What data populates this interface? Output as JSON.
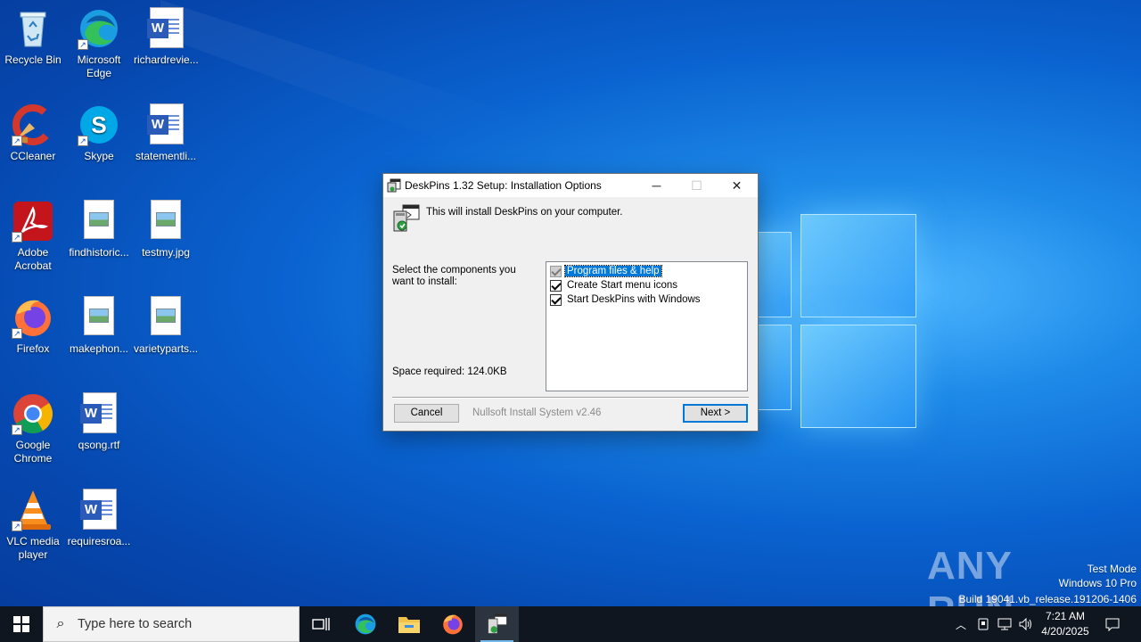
{
  "desktop": {
    "icons": [
      {
        "label": "Recycle Bin",
        "icon": "recycle-bin-icon"
      },
      {
        "label": "Microsoft Edge",
        "icon": "edge-icon"
      },
      {
        "label": "richardrevie...",
        "icon": "word-document-icon"
      },
      {
        "label": "CCleaner",
        "icon": "ccleaner-icon"
      },
      {
        "label": "Skype",
        "icon": "skype-icon"
      },
      {
        "label": "statementli...",
        "icon": "word-document-icon"
      },
      {
        "label": "Adobe Acrobat",
        "icon": "acrobat-icon"
      },
      {
        "label": "findhistoric...",
        "icon": "image-file-icon"
      },
      {
        "label": "testmy.jpg",
        "icon": "image-file-icon"
      },
      {
        "label": "Firefox",
        "icon": "firefox-icon"
      },
      {
        "label": "makephon...",
        "icon": "image-file-icon"
      },
      {
        "label": "varietyparts...",
        "icon": "image-file-icon"
      },
      {
        "label": "Google Chrome",
        "icon": "chrome-icon"
      },
      {
        "label": "qsong.rtf",
        "icon": "word-document-icon"
      },
      {
        "label": "VLC media player",
        "icon": "vlc-icon"
      },
      {
        "label": "requiresroa...",
        "icon": "word-document-icon"
      }
    ]
  },
  "dialog": {
    "title": "DeskPins 1.32 Setup: Installation Options",
    "header_text": "This will install DeskPins on your computer.",
    "components_label": "Select the components you want to install:",
    "space_required": "Space required: 124.0KB",
    "components": [
      {
        "label": "Program files & help",
        "checked": true,
        "disabled": true,
        "selected": true
      },
      {
        "label": "Create Start menu icons",
        "checked": true,
        "disabled": false,
        "selected": false
      },
      {
        "label": "Start DeskPins with Windows",
        "checked": true,
        "disabled": false,
        "selected": false
      }
    ],
    "branding": "Nullsoft Install System v2.46",
    "cancel_label": "Cancel",
    "next_label": "Next >",
    "minimize_glyph": "─",
    "maximize_glyph": "☐",
    "close_glyph": "✕"
  },
  "watermark": {
    "text": "ANY RUN",
    "mode": "Test Mode",
    "edition": "Windows 10 Pro",
    "build": "Build 19041.vb_release.191206-1406"
  },
  "taskbar": {
    "search_placeholder": "Type here to search",
    "time": "7:21 AM",
    "date": "4/20/2025",
    "pinned": [
      "task-view-icon",
      "edge-icon",
      "file-explorer-icon",
      "firefox-icon",
      "deskpins-setup-icon"
    ],
    "active_app": "deskpins-setup-icon"
  },
  "colors": {
    "accent": "#0078d7",
    "taskbar": "#101620",
    "wallpaper": "#0a63d0"
  }
}
